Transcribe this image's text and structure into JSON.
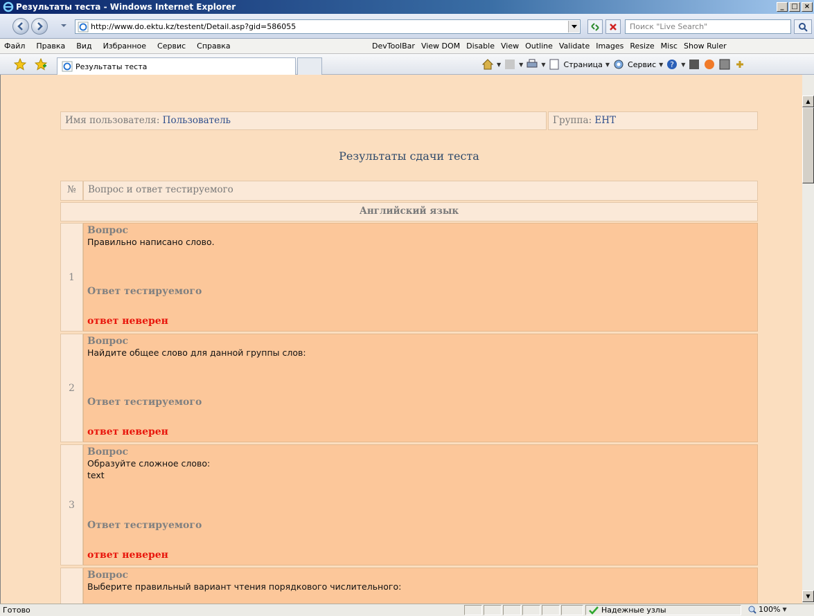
{
  "window": {
    "title": "Результаты теста - Windows Internet Explorer",
    "buttons": {
      "minimize": "_",
      "maximize": "□",
      "close": "×"
    }
  },
  "address": {
    "url": "http://www.do.ektu.kz/testent/Detail.asp?gid=586055",
    "search_placeholder": "Поиск \"Live Search\""
  },
  "menu": {
    "left": [
      "Файл",
      "Правка",
      "Вид",
      "Избранное",
      "Сервис",
      "Справка"
    ],
    "right": [
      "DevToolBar",
      "View DOM",
      "Disable",
      "View",
      "Outline",
      "Validate",
      "Images",
      "Resize",
      "Misc",
      "Show Ruler"
    ]
  },
  "tab": {
    "label": "Результаты теста"
  },
  "commands": {
    "page": "Страница",
    "tools": "Сервис"
  },
  "page": {
    "user_label": "Имя пользователя:",
    "user_value": "Пользователь",
    "group_label": "Группа:",
    "group_value": "ЕНТ",
    "title": "Результаты сдачи теста",
    "col_num": "№",
    "col_question": "Вопрос и ответ тестируемого",
    "subject": "Английский язык",
    "question_label": "Вопрос",
    "answer_label": "Ответ тестируемого",
    "wrong_label": "ответ неверен",
    "questions": [
      {
        "num": "1",
        "text": "Правильно написано слово.",
        "extra": ""
      },
      {
        "num": "2",
        "text": "Найдите общее слово для данной группы слов:",
        "extra": ""
      },
      {
        "num": "3",
        "text": "Образуйте сложное слово:",
        "extra": "text"
      },
      {
        "num": "",
        "text": "Выберите правильный вариант чтения порядкового числительного:",
        "extra": ""
      }
    ]
  },
  "status": {
    "text": "Готово",
    "zone": "Надежные узлы",
    "zoom": "100%"
  },
  "colors": {
    "page_bg": "#fbdebf",
    "question_bg": "#fcc79a",
    "wrong": "#e8160c"
  }
}
